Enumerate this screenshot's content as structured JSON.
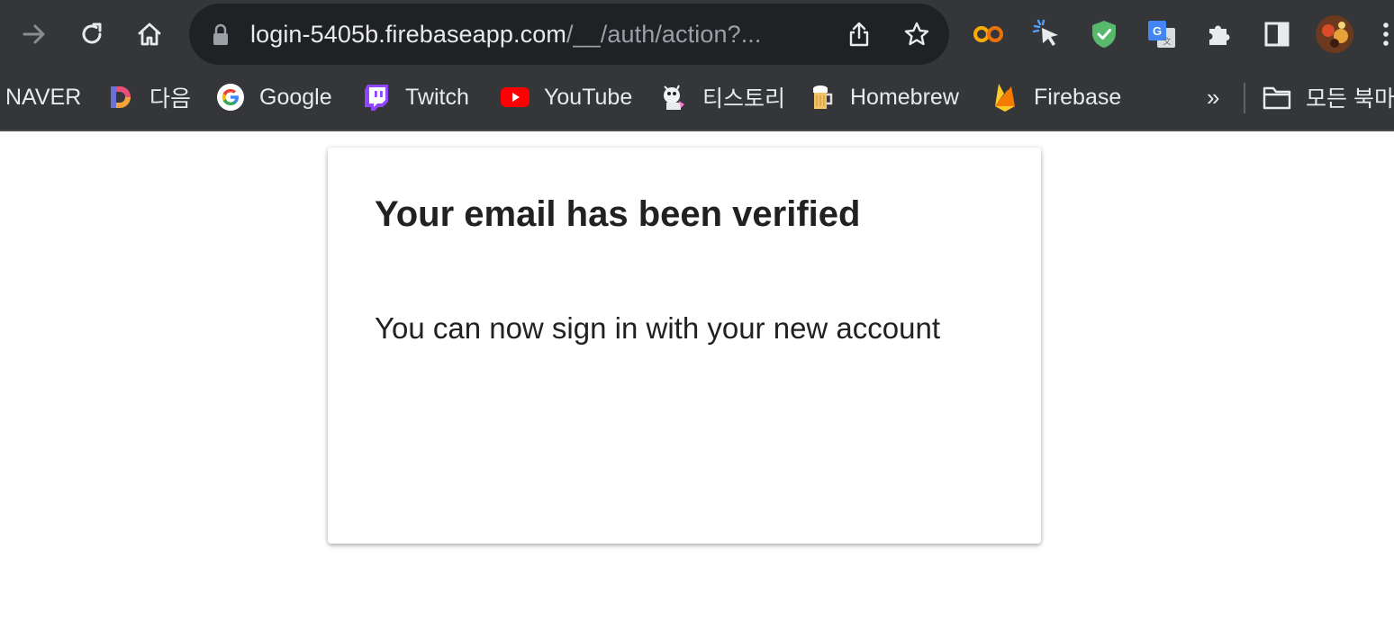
{
  "browser": {
    "url_host": "login-5405b.firebaseapp.com",
    "url_rest": "/__/auth/action?...",
    "nav_icons": [
      "forward-icon",
      "reload-icon",
      "home-icon"
    ],
    "omnibox_icons": [
      "lock-icon",
      "share-icon",
      "star-icon"
    ],
    "extension_icons": [
      "colab-icon",
      "cursor-extension-icon",
      "shield-extension-icon",
      "google-translate-icon",
      "extensions-puzzle-icon",
      "side-panel-icon",
      "profile-avatar",
      "menu-icon"
    ]
  },
  "bookmarks": {
    "items": [
      {
        "label": "NAVER",
        "icon": "none"
      },
      {
        "label": "다음",
        "icon": "daum-icon"
      },
      {
        "label": "Google",
        "icon": "google-icon"
      },
      {
        "label": "Twitch",
        "icon": "twitch-icon"
      },
      {
        "label": "YouTube",
        "icon": "youtube-icon"
      },
      {
        "label": "티스토리",
        "icon": "tistory-icon"
      },
      {
        "label": "Homebrew",
        "icon": "homebrew-icon"
      },
      {
        "label": "Firebase",
        "icon": "firebase-icon"
      }
    ],
    "overflow_label": "»",
    "all_bookmarks_label": "모든 북마크"
  },
  "page": {
    "title": "Your email has been verified",
    "message": "You can now sign in with your new account"
  },
  "colors": {
    "toolbar_bg": "#35363a",
    "omnibox_bg": "#202124",
    "text_primary": "#212121",
    "youtube_red": "#ff0000",
    "twitch_purple": "#9146ff",
    "firebase_orange": "#ffa000"
  }
}
